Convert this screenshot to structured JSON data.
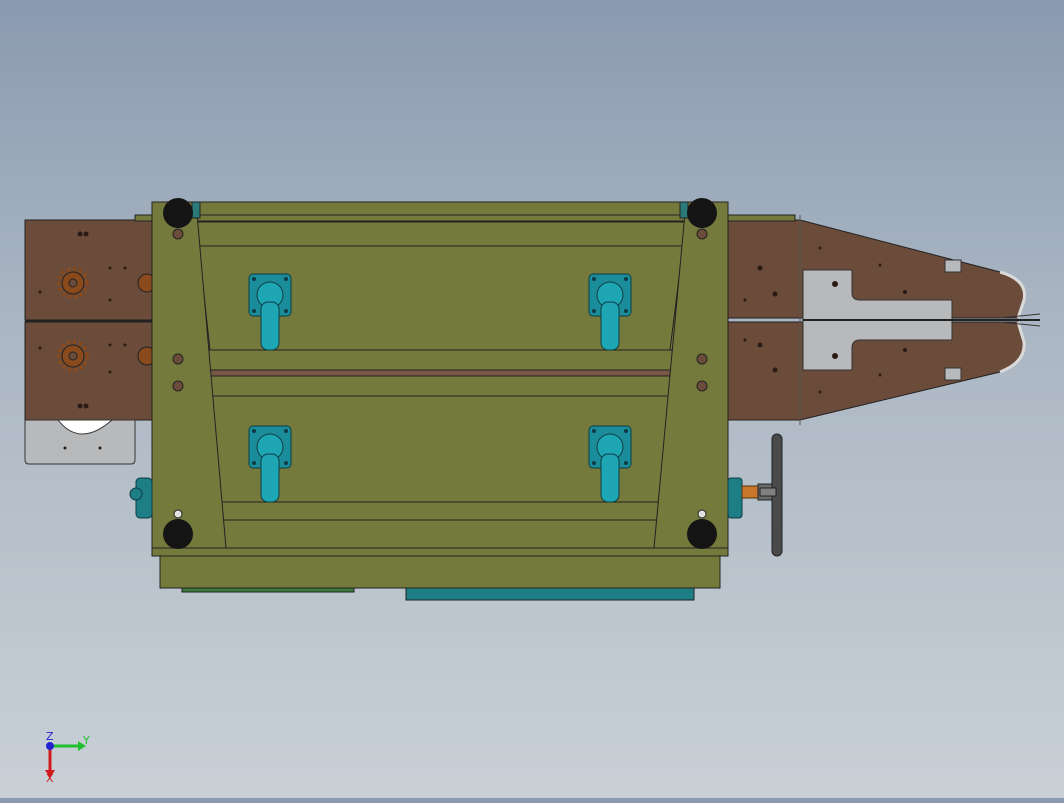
{
  "viewport": {
    "background_top": "#8a9ab0",
    "background_bottom": "#c9d0d6"
  },
  "colors": {
    "frame": "#747a3c",
    "frame_dark": "#4f5424",
    "plate": "#6b4b3a",
    "plate_light": "#7a5847",
    "cut_plate": "#b8b9bb",
    "green_panel": "#3c7a3a",
    "teal": "#1e7e86",
    "caster_teal": "#1b8c9a",
    "sprocket": "#8a4a1c",
    "foot": "#141414",
    "handwheel": "#4a4a4a"
  },
  "triad": {
    "axes": [
      {
        "label": "Y",
        "color": "#1fbf2f",
        "icon": "y-axis-arrow"
      },
      {
        "label": "X",
        "color": "#d01a1a",
        "icon": "x-axis-arrow"
      },
      {
        "label": "Z",
        "color": "#2222cc",
        "icon": "z-axis-dot"
      }
    ]
  }
}
